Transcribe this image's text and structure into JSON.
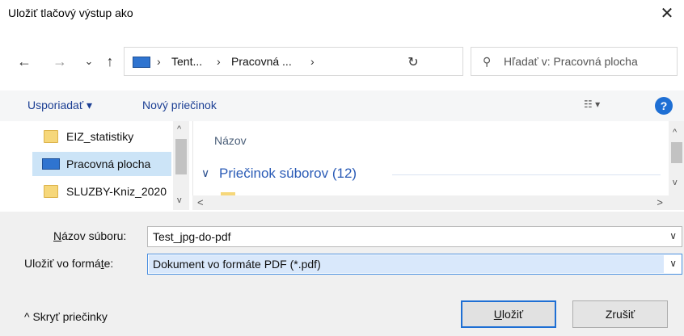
{
  "dialog": {
    "title": "Uložiť tlačový výstup ako",
    "close_glyph": "✕"
  },
  "nav": {
    "back_glyph": "←",
    "forward_glyph": "→",
    "recent_glyph": "⌄",
    "up_glyph": "↑",
    "address": {
      "crumb_sep": "›",
      "crumb1": "Tent...",
      "crumb2": "Pracovná ...",
      "dropdown_glyph": "⌄"
    },
    "refresh_glyph": "↻",
    "search": {
      "icon_glyph": "⚲",
      "placeholder": "Hľadať v: Pracovná plocha"
    }
  },
  "toolbar": {
    "organize_label": "Usporiadať ▾",
    "new_folder_label": "Nový priečinok",
    "view_label": "☷  ▾",
    "help_label": "?"
  },
  "sidebar": {
    "items": [
      {
        "label": "EIZ_statistiky",
        "icon": "folder-icon",
        "selected": false
      },
      {
        "label": "Pracovná plocha",
        "icon": "desktop-icon",
        "selected": true
      },
      {
        "label": "SLUZBY-Kniz_2020",
        "icon": "folder-icon",
        "selected": false
      }
    ]
  },
  "scroll": {
    "up_glyph": "^",
    "down_glyph": "v",
    "left_glyph": "<",
    "right_glyph": ">"
  },
  "files": {
    "column_header": "Názov",
    "group_chevron": "∨",
    "group_label": "Priečinok súborov (12)"
  },
  "form": {
    "filename_label_underlined": "N",
    "filename_label_rest": "ázov súboru:",
    "filename_value": "Test_jpg-do-pdf",
    "format_label_prefix": "Uložiť vo formá",
    "format_label_underlined": "t",
    "format_label_suffix": "e:",
    "format_value": "Dokument vo formáte PDF (*.pdf)",
    "field_chevron": "∨"
  },
  "footer": {
    "hide_folders_label": "^  Skryť priečinky",
    "save_underlined": "U",
    "save_rest": "ložiť",
    "cancel_label": "Zrušiť"
  },
  "colors": {
    "accent": "#1e6fd4",
    "selection": "#cce4f7",
    "link": "#1c3f94"
  }
}
